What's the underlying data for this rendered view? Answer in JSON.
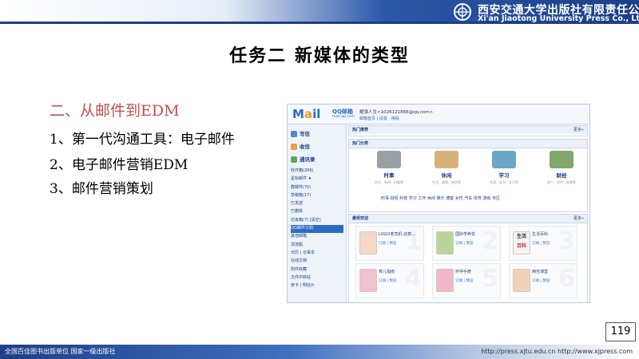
{
  "header": {
    "publisher_cn": "西安交通大学出版社有限责任公司",
    "publisher_en": "Xi'an Jiaotong University Press Co., Ltd."
  },
  "slide": {
    "title": "任务二 新媒体的类型",
    "subtitle": "二、从邮件到EDM",
    "items": [
      "1、第一代沟通工具：电子邮件",
      "2、电子邮件营销EDM",
      "3、邮件营销策划"
    ],
    "page_number": "119"
  },
  "mail": {
    "logo_text": "M",
    "logo_o": "a",
    "logo_tail": "il",
    "logo_sub": "QQ邮箱",
    "logo_url": "mail.qq.com",
    "user_line": "耀强人生<1026121866@qq.com>",
    "user_links": "邮箱首页 | 设置 - 换肤",
    "sidebar_buttons": [
      "写信",
      "收信",
      "通讯录"
    ],
    "sidebar_list": [
      "收件箱(206)",
      "星标邮件 ★",
      "群邮件(70)",
      "草稿箱(17)",
      "已发送",
      "已删除",
      "垃圾箱(7)  [清空]",
      "QQ邮件订阅",
      "其他邮箱",
      "漂流瓶",
      "日历 | 记事本",
      "在线文档",
      "附件收藏",
      "文件中转站",
      "贺卡 | 明信片"
    ],
    "sidebar_highlight_index": 7,
    "hot_recommend": "热门推荐",
    "hot_category": "热门分类",
    "more": "更多»",
    "categories": [
      {
        "name": "时事",
        "desc": "热点、新闻、时事等"
      },
      {
        "name": "休闲",
        "desc": "生活、健康、旅游等"
      },
      {
        "name": "学习",
        "desc": "外语、读书、学习等"
      },
      {
        "name": "财经",
        "desc": "房产、经济、股票等"
      }
    ],
    "tags": "时事  财经  科技  学习  工作  休闲  娱乐  博客  女性  汽车  体育  游戏  专区",
    "favorites_title": "最受欢迎",
    "favorites": [
      {
        "name": "LOGO老司机-创意...",
        "ops": "订阅 | 预览",
        "num": "1"
      },
      {
        "name": "国际学养花",
        "ops": "订阅 | 预览",
        "num": "2"
      },
      {
        "name": "生活百科",
        "ops": "订阅 | 预览",
        "num": "3"
      },
      {
        "name": "育儿指南",
        "ops": "订阅 | 预览",
        "num": "4"
      },
      {
        "name": "怀孕手册",
        "ops": "订阅 | 预览",
        "num": "5"
      },
      {
        "name": "两性课堂",
        "ops": "订阅 | 预览",
        "num": "6"
      }
    ],
    "book_labels": [
      "生活",
      "百科"
    ]
  },
  "footer": {
    "left": "全国百佳图书出版单位  国家一级出版社",
    "right": "http://press.xjtu.edu.cn  http://www.xjpress.com"
  },
  "colors": {
    "accent": "#1c3f86",
    "subtitle": "#c0504d",
    "link": "#2a6cc4"
  },
  "icons": [
    "university-logo-icon",
    "write-mail-icon",
    "inbox-icon",
    "contacts-icon"
  ]
}
